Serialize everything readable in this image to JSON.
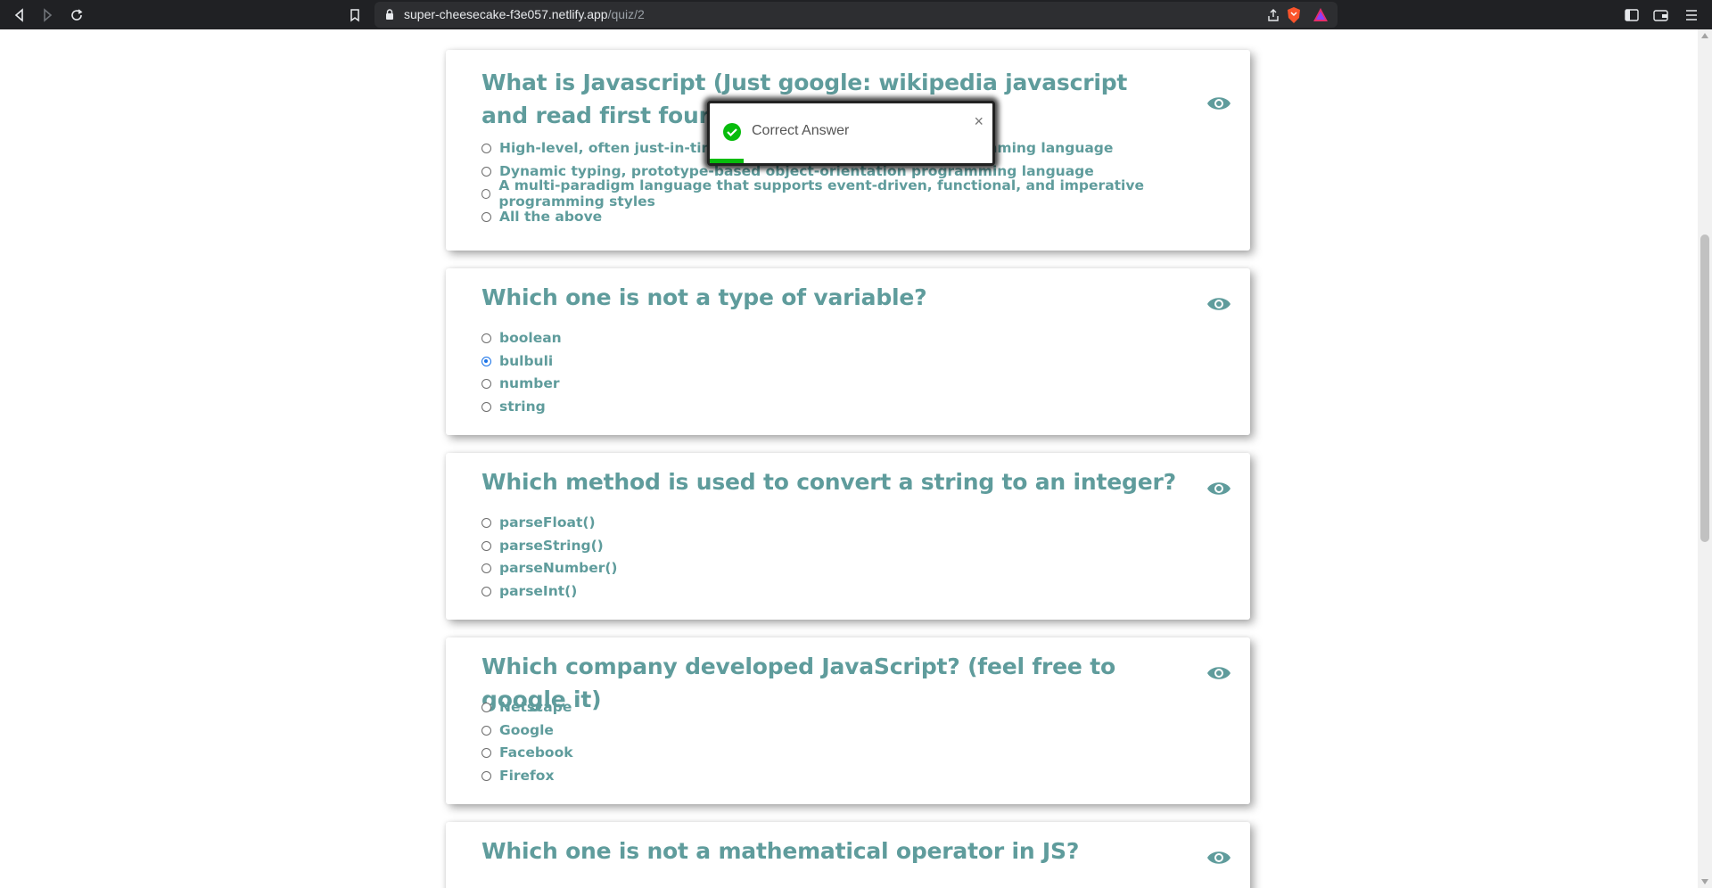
{
  "browser": {
    "url_host": "super-cheesecake-f3e057.netlify.app",
    "url_path": "/quiz/2"
  },
  "toast": {
    "message": "Correct Answer",
    "close_label": "×",
    "accent_color": "#07bc0c",
    "progress": 0.12
  },
  "colors": {
    "question_text": "#5f9c9c",
    "radio_checked": "#1a73e8"
  },
  "questions": [
    {
      "title": "What is Javascript (Just google: wikipedia javascript and read first four paragraphs)",
      "options": [
        "High-level, often just-in-time compiled multi-paradigm programming language",
        "Dynamic typing, prototype-based object-orientation programming language",
        "A multi-paradigm language that supports event-driven, functional, and imperative programming styles",
        "All the above"
      ],
      "selected": -1
    },
    {
      "title": "Which one is not a type of variable?",
      "options": [
        "boolean",
        "bulbuli",
        "number",
        "string"
      ],
      "selected": 1
    },
    {
      "title": "Which method is used to convert a string to an integer?",
      "options": [
        "parseFloat()",
        "parseString()",
        "parseNumber()",
        "parseInt()"
      ],
      "selected": -1
    },
    {
      "title": "Which company developed JavaScript? (feel free to google it)",
      "options": [
        "Netscape",
        "Google",
        "Facebook",
        "Firefox"
      ],
      "selected": -1
    },
    {
      "title": "Which one is not a mathematical operator in JS?",
      "options": [],
      "selected": -1
    }
  ]
}
